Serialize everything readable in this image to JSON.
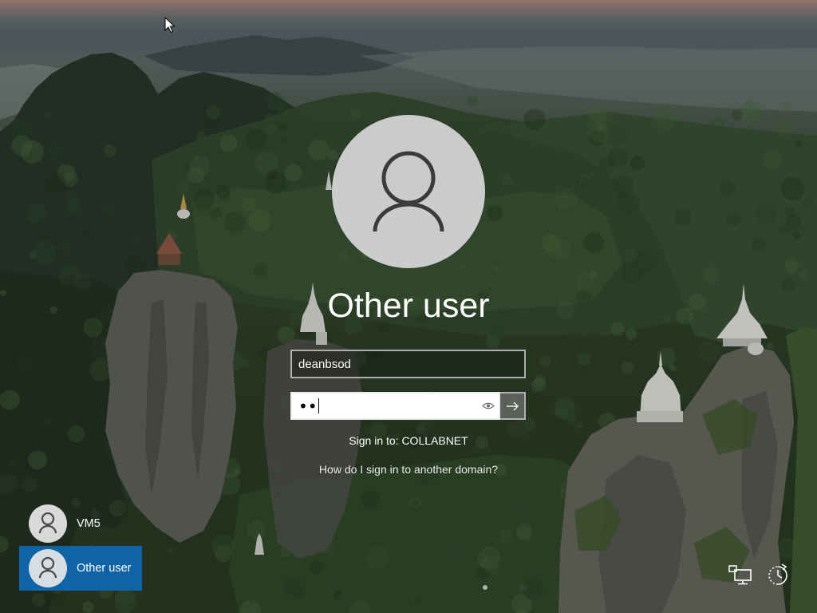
{
  "login_screen": {
    "account_title": "Other user",
    "username_value": "deanbsod",
    "password_display": "••",
    "sign_in_to": "Sign in to: COLLABNET",
    "help_link": "How do I sign in to another domain?"
  },
  "user_list": [
    {
      "label": "VM5",
      "selected": false,
      "icon": "user-avatar-icon"
    },
    {
      "label": "Other user",
      "selected": true,
      "icon": "user-avatar-icon"
    }
  ],
  "icons": {
    "large_avatar": "user-avatar-icon",
    "reveal_password": "eye-icon",
    "submit": "arrow-right-icon",
    "network": "network-icon",
    "ease_of_access": "ease-of-access-icon",
    "pointer": "mouse-cursor-icon"
  },
  "colors": {
    "selected_user_background": "#0f64a8",
    "text": "#ffffff",
    "avatar_fill": "#d6d7d7"
  }
}
